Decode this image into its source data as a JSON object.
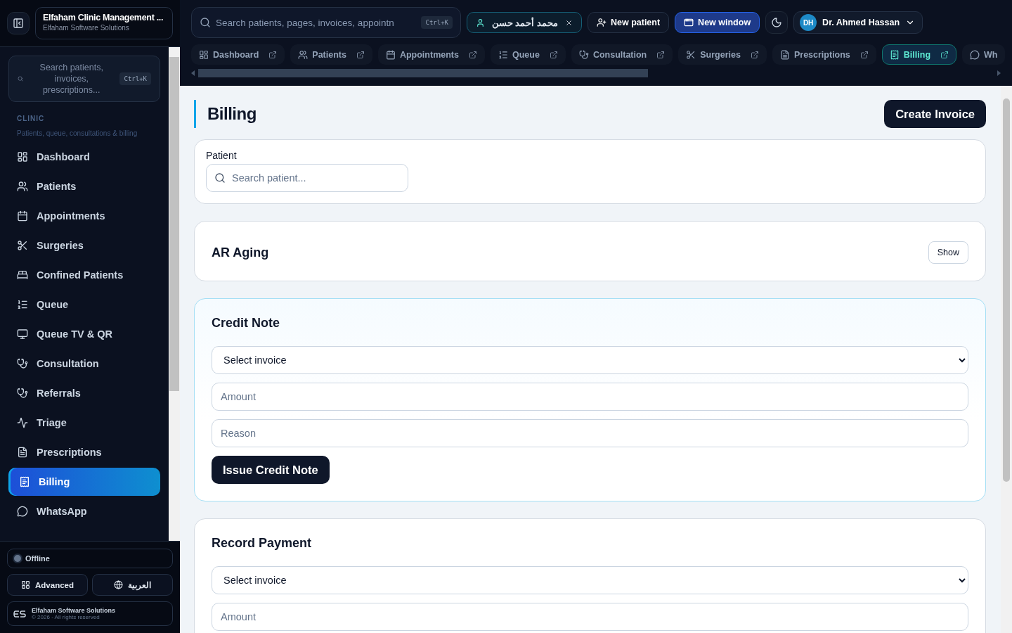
{
  "sidebar": {
    "app_title": "Elfaham Clinic Management ...",
    "app_subtitle": "Elfaham Software Solutions",
    "search": {
      "placeholder": "Search patients, invoices, prescriptions...",
      "shortcut": "Ctrl+K"
    },
    "section": {
      "title": "CLINIC",
      "subtitle": "Patients, queue, consultations & billing"
    },
    "items": [
      {
        "label": "Dashboard",
        "selected": false
      },
      {
        "label": "Patients",
        "selected": false
      },
      {
        "label": "Appointments",
        "selected": false
      },
      {
        "label": "Surgeries",
        "selected": false
      },
      {
        "label": "Confined Patients",
        "selected": false
      },
      {
        "label": "Queue",
        "selected": false
      },
      {
        "label": "Queue TV & QR",
        "selected": false
      },
      {
        "label": "Consultation",
        "selected": false
      },
      {
        "label": "Referrals",
        "selected": false
      },
      {
        "label": "Triage",
        "selected": false
      },
      {
        "label": "Prescriptions",
        "selected": false
      },
      {
        "label": "Billing",
        "selected": true
      },
      {
        "label": "WhatsApp",
        "selected": false
      }
    ],
    "status": {
      "label": "Offline",
      "online": false
    },
    "advanced_button": "Advanced",
    "language_button": "العربية",
    "footer": {
      "company": "Elfaham Software Solutions",
      "copyright": "© 2026 - All rights reserved"
    }
  },
  "header": {
    "search": {
      "placeholder": "Search patients, pages, invoices, appointn",
      "shortcut": "Ctrl+K"
    },
    "patient_chip": "محمد أحمد حسن",
    "new_patient": "New patient",
    "new_window": "New window",
    "user": {
      "initials": "DH",
      "name": "Dr. Ahmed Hassan"
    },
    "tabs": [
      {
        "label": "Dashboard",
        "selected": false
      },
      {
        "label": "Patients",
        "selected": false
      },
      {
        "label": "Appointments",
        "selected": false
      },
      {
        "label": "Queue",
        "selected": false
      },
      {
        "label": "Consultation",
        "selected": false
      },
      {
        "label": "Surgeries",
        "selected": false
      },
      {
        "label": "Prescriptions",
        "selected": false
      },
      {
        "label": "Billing",
        "selected": true
      },
      {
        "label": "Wh",
        "selected": false
      }
    ]
  },
  "page": {
    "title": "Billing",
    "create_button": "Create Invoice",
    "patient_card": {
      "label": "Patient",
      "placeholder": "Search patient..."
    },
    "ar_aging": {
      "title": "AR Aging",
      "button": "Show"
    },
    "credit_note": {
      "title": "Credit Note",
      "highlighted": true,
      "select": "Select invoice",
      "amount_placeholder": "Amount",
      "reason_placeholder": "Reason",
      "button": "Issue Credit Note"
    },
    "record_payment": {
      "title": "Record Payment",
      "highlighted": false,
      "select": "Select invoice",
      "amount_placeholder": "Amount"
    }
  }
}
